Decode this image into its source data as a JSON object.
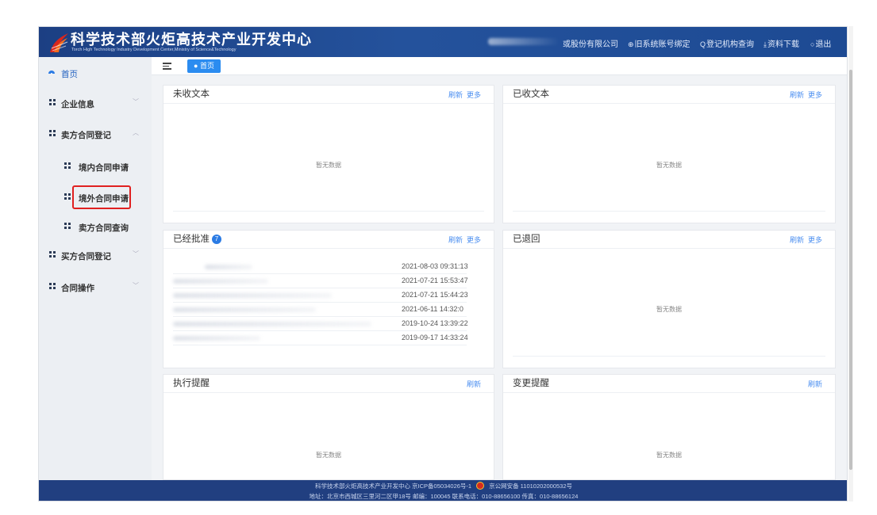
{
  "header": {
    "title": "科学技术部火炬高技术产业开发中心",
    "subtitle": "Torch High Technology Industry Development Center,Ministry of Science&Technology",
    "company": "或股份有限公司",
    "links": {
      "bind_account": "旧系统账号绑定",
      "org_query": "登记机构查询",
      "download": "资料下载",
      "logout": "退出"
    },
    "link_icons": [
      "link-icon",
      "search-icon",
      "download-icon",
      "power-icon"
    ]
  },
  "sidebar": {
    "home": "首页",
    "items": [
      {
        "label": "企业信息",
        "expanded": false
      },
      {
        "label": "卖方合同登记",
        "expanded": true
      },
      {
        "label": "境内合同申请",
        "sub": true,
        "highlighted": true
      },
      {
        "label": "境外合同申请",
        "sub": true
      },
      {
        "label": "卖方合同查询",
        "sub": true
      },
      {
        "label": "买方合同登记",
        "expanded": false
      },
      {
        "label": "合同操作",
        "expanded": false
      }
    ]
  },
  "tabbar": {
    "home_tab": "● 首页"
  },
  "panels": {
    "unreceived": {
      "title": "未收文本",
      "refresh": "刷新",
      "more": "更多",
      "empty": "暂无数据"
    },
    "received": {
      "title": "已收文本",
      "refresh": "刷新",
      "more": "更多",
      "empty": "暂无数据"
    },
    "approved": {
      "title": "已经批准",
      "badge": "7",
      "refresh": "刷新",
      "more": "更多",
      "timestamps": [
        "2021-08-03 09:31:13",
        "2021-07-21 15:53:47",
        "2021-07-21 15:44:23",
        "2021-06-11 14:32:0",
        "2019-10-24 13:39:22",
        "2019-09-17 14:33:24"
      ]
    },
    "returned": {
      "title": "已退回",
      "refresh": "刷新",
      "more": "更多",
      "empty": "暂无数据"
    },
    "exec_reminder": {
      "title": "执行提醒",
      "refresh": "刷新",
      "empty": "暂无数据"
    },
    "change_reminder": {
      "title": "变更提醒",
      "refresh": "刷新",
      "empty": "暂无数据"
    }
  },
  "footer": {
    "line1_left": "科学技术部火炬高技术产业开发中心 京ICP备05034026号-1",
    "line1_right": "京公网安备 11010202000532号",
    "line2": "地址：北京市西城区三里河二区甲18号 邮编：100045 联系电话：010-88656100    传真：010-88656124"
  },
  "colors": {
    "header_bg": "#1c3f83",
    "accent": "#2b8cf0",
    "link": "#4a8ef0",
    "highlight_box": "#e02020",
    "footer_bg": "#213f80"
  }
}
